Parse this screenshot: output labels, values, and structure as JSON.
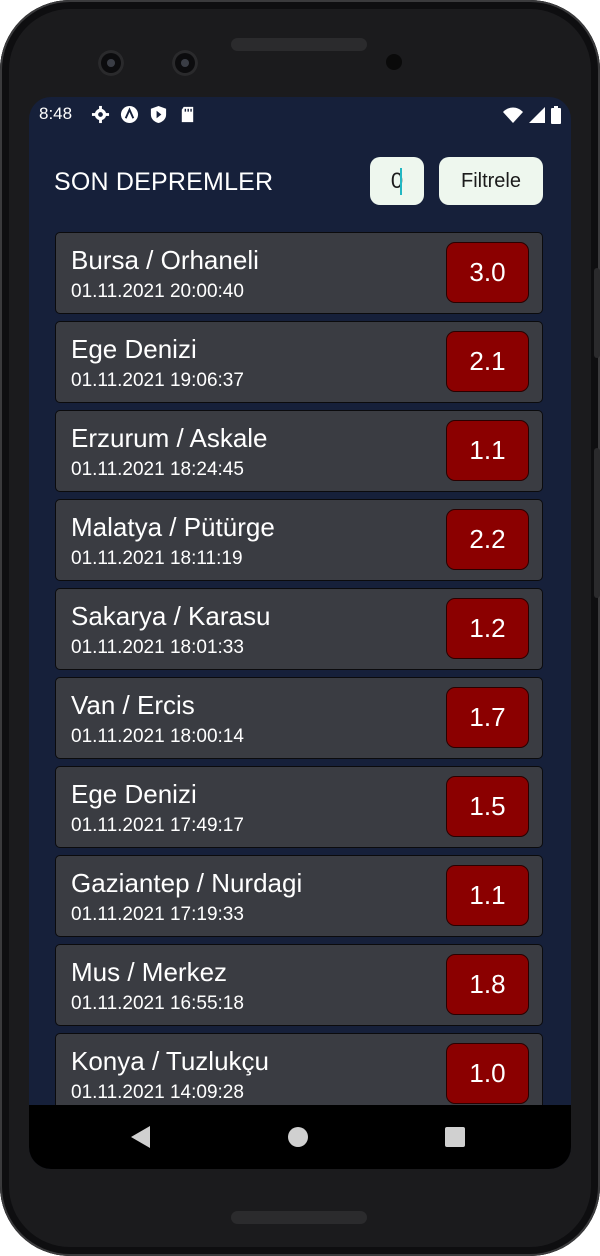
{
  "status_bar": {
    "time": "8:48",
    "left_icons": [
      "gear-icon",
      "vpn-icon",
      "play-shield-icon",
      "sd-card-icon"
    ],
    "right_icons": [
      "wifi-icon",
      "signal-icon",
      "battery-icon"
    ]
  },
  "header": {
    "title": "SON DEPREMLER",
    "filter_value": "0",
    "filter_button": "Filtrele"
  },
  "earthquakes": [
    {
      "location": "Bursa / Orhaneli",
      "datetime": "01.11.2021 20:00:40",
      "magnitude": "3.0"
    },
    {
      "location": "Ege Denizi",
      "datetime": "01.11.2021 19:06:37",
      "magnitude": "2.1"
    },
    {
      "location": "Erzurum / Askale",
      "datetime": "01.11.2021 18:24:45",
      "magnitude": "1.1"
    },
    {
      "location": "Malatya / Pütürge",
      "datetime": "01.11.2021 18:11:19",
      "magnitude": "2.2"
    },
    {
      "location": "Sakarya / Karasu",
      "datetime": "01.11.2021 18:01:33",
      "magnitude": "1.2"
    },
    {
      "location": "Van / Ercis",
      "datetime": "01.11.2021 18:00:14",
      "magnitude": "1.7"
    },
    {
      "location": "Ege Denizi",
      "datetime": "01.11.2021 17:49:17",
      "magnitude": "1.5"
    },
    {
      "location": "Gaziantep / Nurdagi",
      "datetime": "01.11.2021 17:19:33",
      "magnitude": "1.1"
    },
    {
      "location": "Mus / Merkez",
      "datetime": "01.11.2021 16:55:18",
      "magnitude": "1.8"
    },
    {
      "location": "Konya / Tuzlukçu",
      "datetime": "01.11.2021 14:09:28",
      "magnitude": "1.0"
    }
  ],
  "colors": {
    "background": "#16203a",
    "card": "#3a3c42",
    "magnitude_badge": "#8b0000",
    "input_bg": "#eef7ee"
  },
  "nav_bar": [
    "back-icon",
    "home-icon",
    "recents-icon"
  ]
}
